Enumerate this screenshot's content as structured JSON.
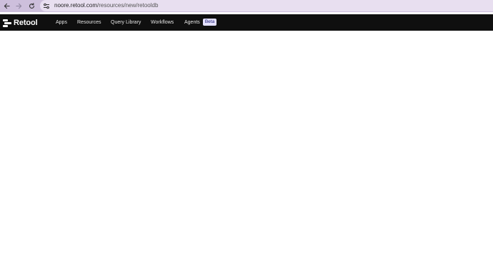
{
  "browser": {
    "url_host": "noore.retool.com",
    "url_path": "/resources/new/retooldb",
    "back_icon": "arrow-left-icon",
    "forward_icon": "arrow-right-icon",
    "reload_icon": "reload-icon",
    "site_info_icon": "tune-icon",
    "chrome_color": "#cdbfdc"
  },
  "app": {
    "brand": "Retool",
    "nav_items": [
      "Apps",
      "Resources",
      "Query Library",
      "Workflows",
      "Agents"
    ],
    "beta_badge": "Beta",
    "nav_background": "#0f0f0f"
  }
}
